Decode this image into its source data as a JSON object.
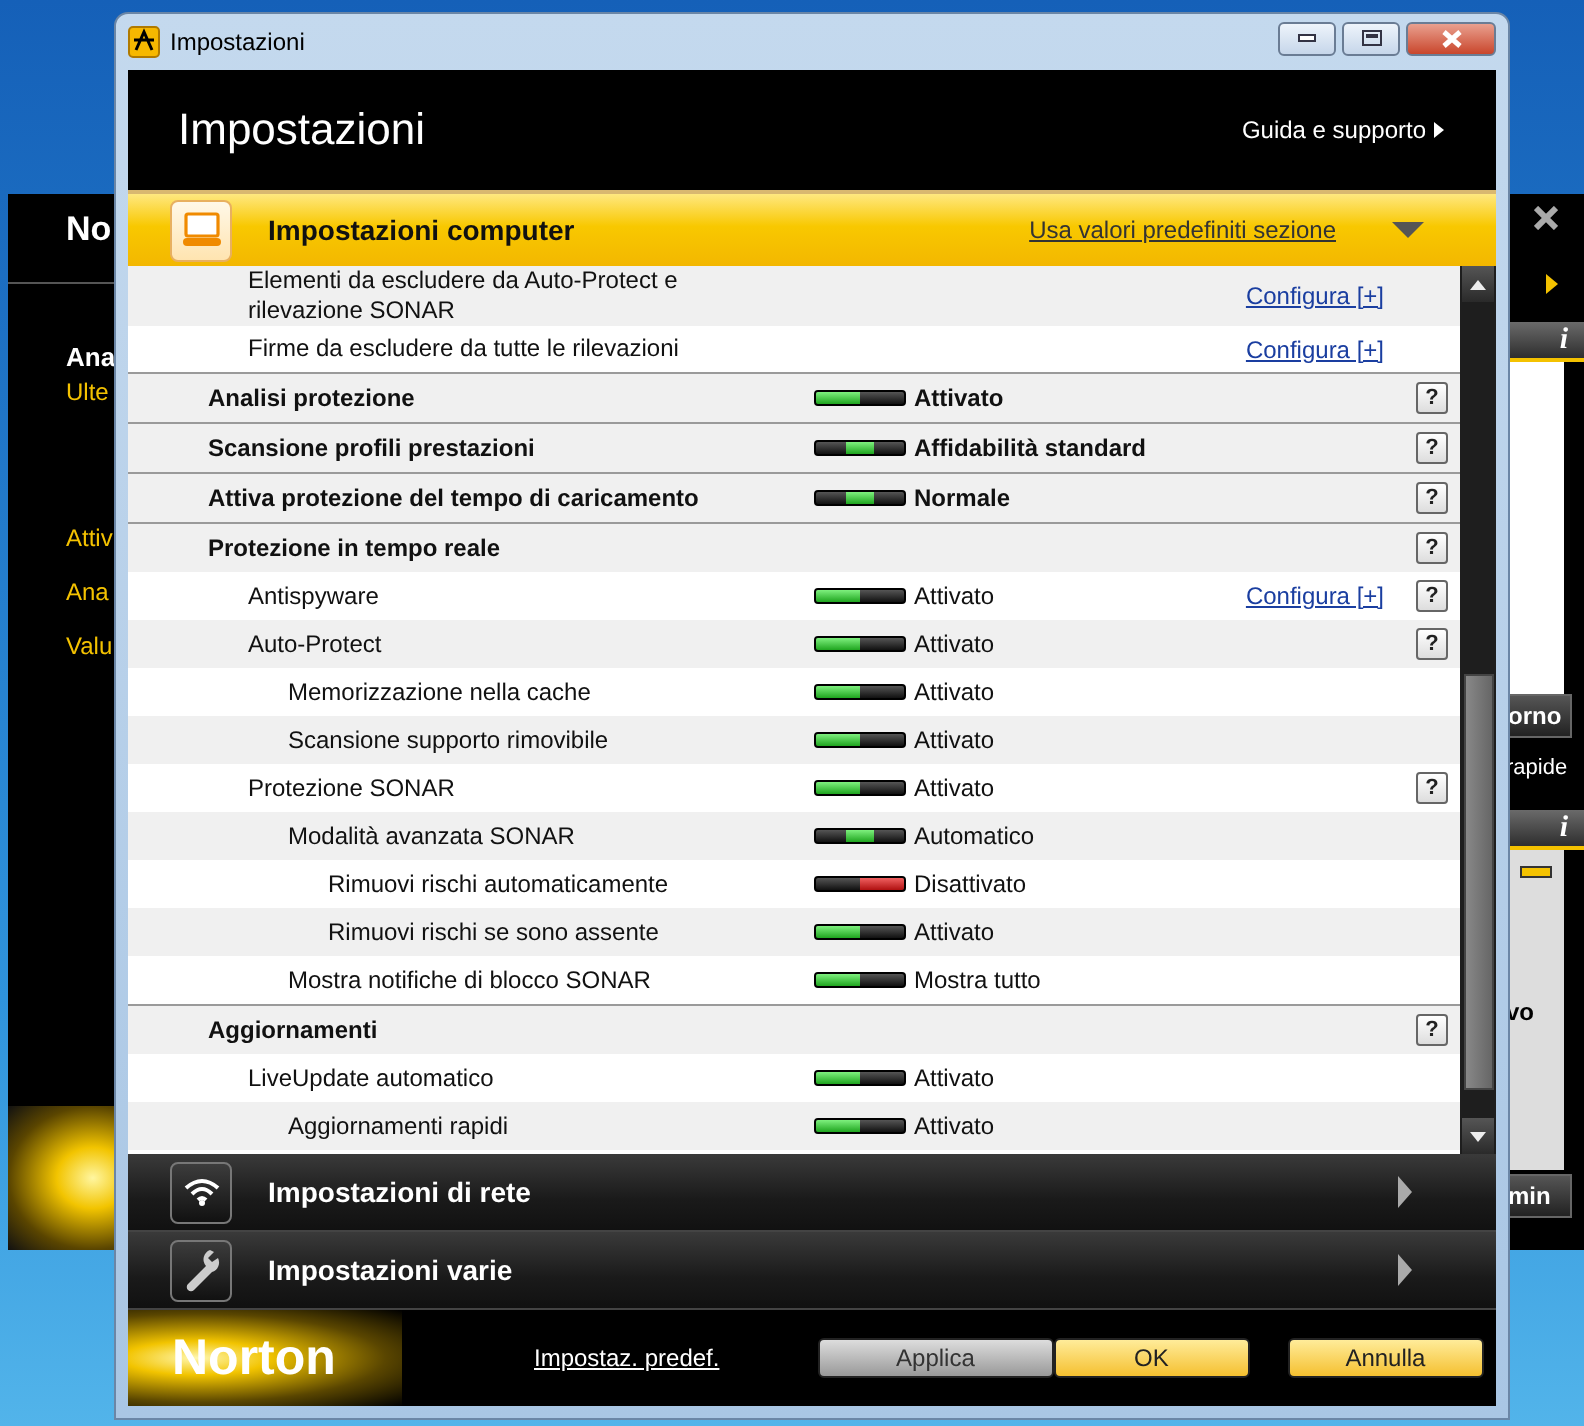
{
  "background_window": {
    "left": [
      {
        "kind": "title",
        "text": "No"
      },
      {
        "kind": "heading",
        "text": "Ana"
      },
      {
        "kind": "subtitle",
        "text": "Ulte"
      },
      {
        "kind": "link",
        "text": "Attiv"
      },
      {
        "kind": "link",
        "text": "Ana"
      },
      {
        "kind": "link",
        "text": "Valu"
      }
    ],
    "right": {
      "badge_1": "i",
      "button_1": "orno",
      "caption": "rapide",
      "badge_2": "i",
      "panel_text": "vo",
      "button_2": "min"
    }
  },
  "window": {
    "title": "Impostazioni",
    "heading": "Impostazioni",
    "help_link": "Guida e supporto"
  },
  "sections": [
    {
      "kind": "computer",
      "title": "Impostazioni computer",
      "expanded": true,
      "reset_link": "Usa valori predefiniti sezione"
    },
    {
      "kind": "network",
      "title": "Impostazioni di rete",
      "expanded": false
    },
    {
      "kind": "tools",
      "title": "Impostazioni varie",
      "expanded": false
    }
  ],
  "exclusions": [
    {
      "label": "Elementi da escludere da Auto-Protect e rilevazione SONAR",
      "link": "Configura [+]"
    },
    {
      "label": "Firme da escludere da tutte le rilevazioni",
      "link": "Configura [+]"
    }
  ],
  "settings": [
    {
      "label": "Analisi protezione",
      "level": 0,
      "value": "Attivato",
      "help": "?"
    },
    {
      "label": "Scansione profili prestazioni",
      "level": 0.5,
      "value": "Affidabilità standard",
      "help": "?"
    },
    {
      "label": "Attiva protezione del tempo di caricamento",
      "level": 0.5,
      "value": "Normale",
      "help": "?"
    },
    {
      "label": "Protezione in tempo reale",
      "help": "?",
      "children": [
        {
          "label": "Antispyware",
          "level": 0,
          "value": "Attivato",
          "link": "Configura [+]",
          "help": "?"
        },
        {
          "label": "Auto-Protect",
          "level": 0,
          "value": "Attivato",
          "help": "?",
          "children": [
            {
              "label": "Memorizzazione nella cache",
              "level": 0,
              "value": "Attivato"
            },
            {
              "label": "Scansione supporto rimovibile",
              "level": 0,
              "value": "Attivato"
            }
          ]
        },
        {
          "label": "Protezione SONAR",
          "level": 0,
          "value": "Attivato",
          "help": "?",
          "children": [
            {
              "label": "Modalità avanzata SONAR",
              "level": 0.5,
              "value": "Automatico",
              "children": [
                {
                  "label": "Rimuovi rischi automaticamente",
                  "level": 1,
                  "value": "Disattivato"
                },
                {
                  "label": "Rimuovi rischi se sono assente",
                  "level": 0,
                  "value": "Attivato"
                }
              ]
            },
            {
              "label": "Mostra notifiche di blocco SONAR",
              "level": 0,
              "value": "Mostra tutto"
            }
          ]
        }
      ]
    },
    {
      "label": "Aggiornamenti",
      "help": "?",
      "children": [
        {
          "label": "LiveUpdate automatico",
          "level": 0,
          "value": "Attivato",
          "children": [
            {
              "label": "Aggiornamenti rapidi",
              "level": 0,
              "value": "Attivato"
            }
          ]
        }
      ]
    }
  ],
  "footer": {
    "brand": "Norton",
    "defaults_link": "Impostaz. predef.",
    "buttons": [
      {
        "label": "Applica",
        "disabled": true
      },
      {
        "label": "OK",
        "disabled": false
      },
      {
        "label": "Annulla",
        "disabled": false
      }
    ]
  }
}
